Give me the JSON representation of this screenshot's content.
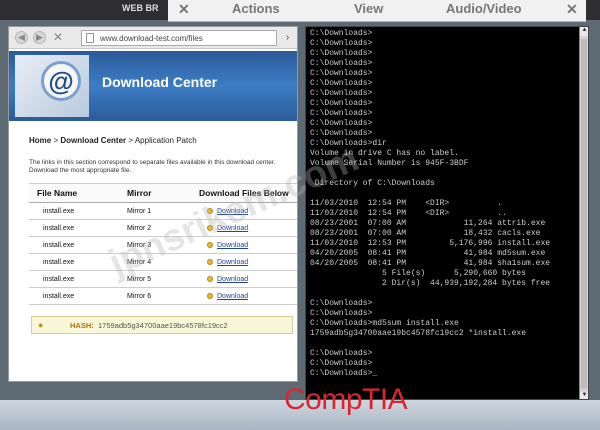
{
  "topbar": {
    "window_title": "WEB BR",
    "tabs": {
      "close_glyph": "✕",
      "actions": "Actions",
      "view": "View",
      "audio_video": "Audio/Video",
      "close2_glyph": "✕"
    }
  },
  "browser": {
    "back_glyph": "◀",
    "forward_glyph": "▶",
    "stop_glyph": "✕",
    "url": "www.download-test.com/files",
    "go_glyph": "›",
    "banner_title": "Download Center",
    "at_glyph": "@",
    "breadcrumb": {
      "home": "Home",
      "sep1": " > ",
      "download_center": "Download Center",
      "sep2": " > ",
      "current": "Application Patch"
    },
    "intro": "The links in this section correspond to separate files available in this download center. Download the most appropriate file.",
    "table": {
      "headers": [
        "File Name",
        "Mirror",
        "Download Files Below"
      ],
      "rows": [
        {
          "file": "install.exe",
          "mirror": "Mirror 1",
          "link": "Download"
        },
        {
          "file": "install.exe",
          "mirror": "Mirror 2",
          "link": "Download"
        },
        {
          "file": "install.exe",
          "mirror": "Mirror 3",
          "link": "Download"
        },
        {
          "file": "install.exe",
          "mirror": "Mirror 4",
          "link": "Download"
        },
        {
          "file": "install.exe",
          "mirror": "Mirror 5",
          "link": "Download"
        },
        {
          "file": "install.exe",
          "mirror": "Mirror 6",
          "link": "Download"
        }
      ]
    },
    "hash": {
      "label": "HASH:",
      "value": "1759adb5g34700aae19bc4578fc19cc2"
    }
  },
  "terminal": {
    "lines": [
      "C:\\Downloads>",
      "C:\\Downloads>",
      "C:\\Downloads>",
      "C:\\Downloads>",
      "C:\\Downloads>",
      "C:\\Downloads>",
      "C:\\Downloads>",
      "C:\\Downloads>",
      "C:\\Downloads>",
      "C:\\Downloads>",
      "C:\\Downloads>",
      "C:\\Downloads>dir",
      "Volume in drive C has no label.",
      "Volume Serial Number is 945F-3BDF",
      "",
      " Directory of C:\\Downloads",
      "",
      "11/03/2010  12:54 PM    <DIR>          .",
      "11/03/2010  12:54 PM    <DIR>          ..",
      "08/23/2001  07:00 AM            11,264 attrib.exe",
      "08/23/2001  07:00 AM            18,432 cacls.exe",
      "11/03/2010  12:53 PM         5,176,996 install.exe",
      "04/20/2005  08:41 PM            41,984 md5sum.exe",
      "04/20/2005  08:41 PM            41,984 sha1sum.exe",
      "               5 File(s)      5,290,660 bytes",
      "               2 Dir(s)  44,939,192,284 bytes free",
      "",
      "C:\\Downloads>",
      "C:\\Downloads>",
      "C:\\Downloads>md5sum install.exe",
      "1759adb5g34700aae19bc4578fc19cc2 *install.exe",
      "",
      "C:\\Downloads>",
      "C:\\Downloads>",
      "C:\\Downloads>_"
    ],
    "scroll_up_glyph": "▲",
    "scroll_down_glyph": "▼"
  },
  "footer": {
    "brand": "CompTIA",
    "tm": "."
  },
  "watermark": "jpnsrikem.com"
}
